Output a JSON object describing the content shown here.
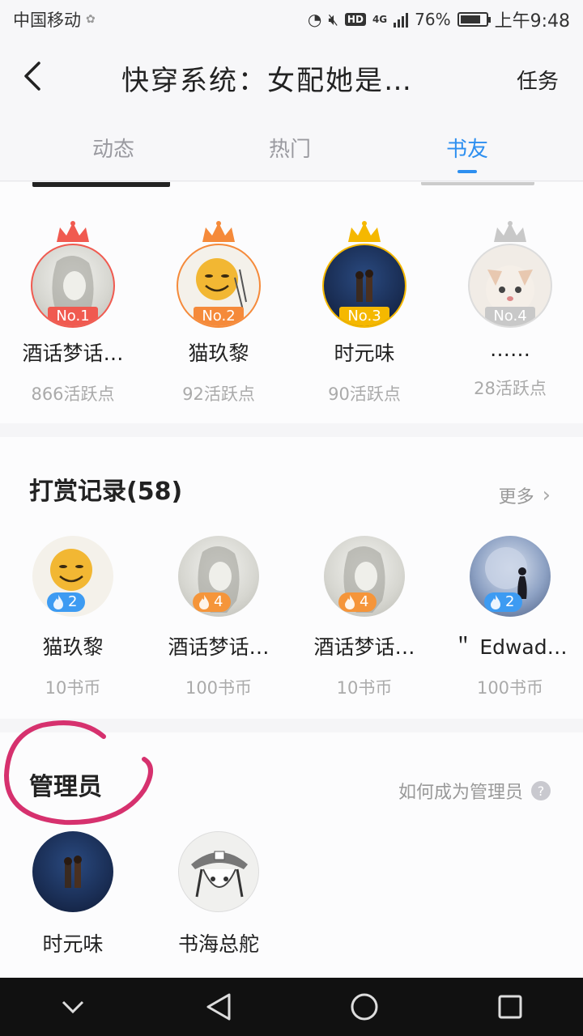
{
  "status_bar": {
    "carrier": "中国移动",
    "network": "4G",
    "hd": "HD",
    "battery": "76%",
    "time": "上午9:48"
  },
  "header": {
    "title": "快穿系统：女配她是…",
    "task": "任务"
  },
  "tabs": [
    {
      "label": "动态",
      "active": false
    },
    {
      "label": "热门",
      "active": false
    },
    {
      "label": "书友",
      "active": true
    }
  ],
  "ranking": {
    "items": [
      {
        "name": "酒话梦话…",
        "points": "866活跃点",
        "rank": "No.1",
        "color": "#f05a50"
      },
      {
        "name": "猫玖黎",
        "points": "92活跃点",
        "rank": "No.2",
        "color": "#f58a3a"
      },
      {
        "name": "时元味",
        "points": "90活跃点",
        "rank": "No.3",
        "color": "#f5b800"
      },
      {
        "name": "……",
        "points": "28活跃点",
        "rank": "No.4",
        "color": "#c8c8c8"
      }
    ]
  },
  "tips": {
    "title": "打赏记录(58)",
    "more": "更多",
    "items": [
      {
        "name": "猫玖黎",
        "amount": "10书币",
        "level": "2",
        "badge_color": "#3d9bf2"
      },
      {
        "name": "酒话梦话…",
        "amount": "100书币",
        "level": "4",
        "badge_color": "#f5953a"
      },
      {
        "name": "酒话梦话…",
        "amount": "10书币",
        "level": "4",
        "badge_color": "#f5953a"
      },
      {
        "name": "＂ Edwad…",
        "amount": "100书币",
        "level": "2",
        "badge_color": "#3d9bf2"
      }
    ]
  },
  "admins": {
    "title": "管理员",
    "how_to": "如何成为管理员",
    "items": [
      {
        "name": "时元味"
      },
      {
        "name": "书海总舵"
      }
    ]
  },
  "colors": {
    "accent": "#2d8ff0",
    "annotation": "#d6316e"
  }
}
